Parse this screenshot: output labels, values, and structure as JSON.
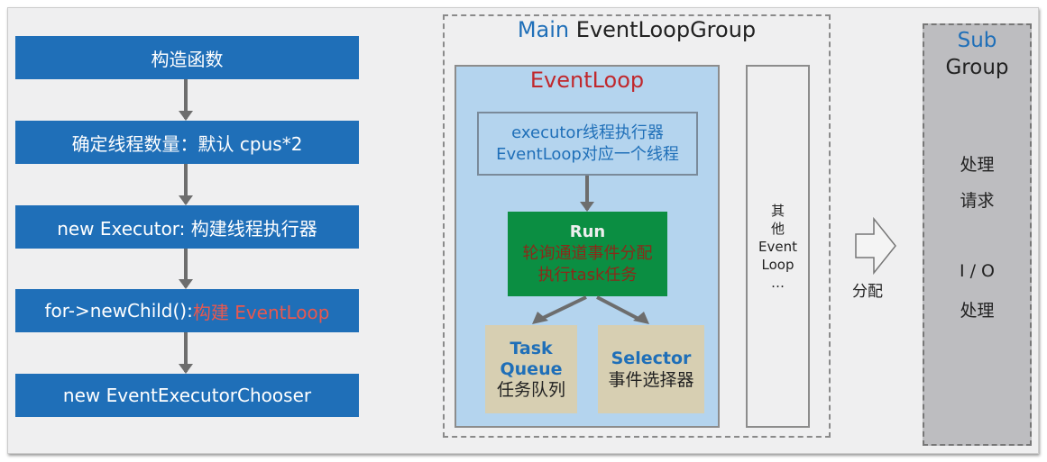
{
  "steps": [
    {
      "text": "构造函数"
    },
    {
      "text": "确定线程数量：默认 cpus*2"
    },
    {
      "text": "new Executor: 构建线程执行器"
    },
    {
      "text": "for->newChild():",
      "highlight": "构建 EventLoop"
    },
    {
      "text": "new EventExecutorChooser"
    }
  ],
  "main_group": {
    "title_accent": "Main",
    "title": "EventLoopGroup"
  },
  "event_loop": {
    "title": "EventLoop",
    "executor_line1": "executor线程执行器",
    "executor_line2": "EventLoop对应一个线程",
    "run_title": "Run",
    "run_line1": "轮询通道事件分配",
    "run_line2": "执行task任务",
    "task_queue_l1": "Task",
    "task_queue_l2": "Queue",
    "task_queue_l3": "任务队列",
    "selector_l1": "Selector",
    "selector_l2": "事件选择器"
  },
  "other": {
    "l1": "其",
    "l2": "他",
    "l3": "Event",
    "l4": "Loop",
    "l5": "…"
  },
  "dispatch_label": "分配",
  "sub_group": {
    "title_accent": "Sub",
    "title": "Group",
    "l1": "处理",
    "l2": "请求",
    "l3": "I / O",
    "l4": "处理"
  },
  "colors": {
    "blue": "#1f6fb8",
    "green": "#0b8e42",
    "tan": "#d7cfb2",
    "light_blue": "#b4d4ee",
    "red": "#c0282d"
  }
}
